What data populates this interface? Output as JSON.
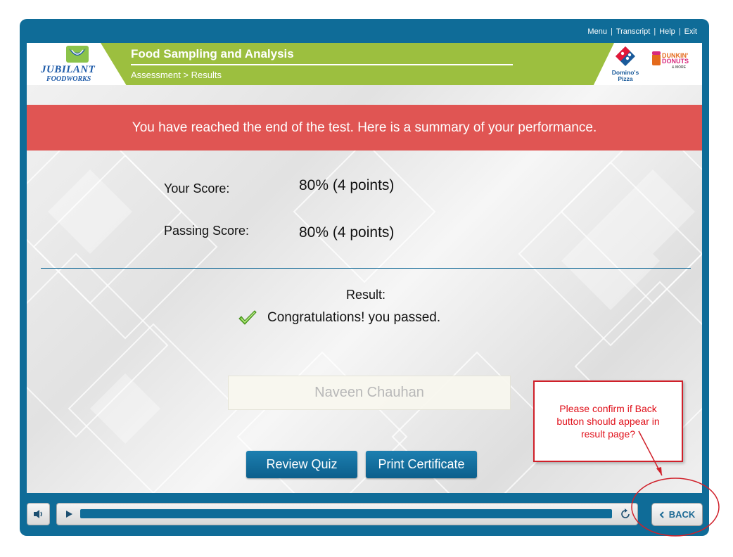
{
  "top_nav": {
    "menu": "Menu",
    "transcript": "Transcript",
    "help": "Help",
    "exit": "Exit",
    "separator": "|"
  },
  "header": {
    "logo_line1": "JUBILANT",
    "logo_line2": "FOODWORKS",
    "course_title": "Food Sampling and Analysis",
    "breadcrumb": "Assessment > Results",
    "brand_dominos": "Domino's Pizza",
    "brand_dunkin_line1": "DUNKIN'",
    "brand_dunkin_line2": "DONUTS",
    "brand_dunkin_more": "& MORE"
  },
  "banner": {
    "text": "You have reached the end of the test. Here is a summary of your performance."
  },
  "summary": {
    "your_score_label": "Your Score:",
    "your_score_value": "80% (4 points)",
    "passing_score_label": "Passing Score:",
    "passing_score_value": "80% (4 points)",
    "result_label": "Result:",
    "result_text": "Congratulations! you passed."
  },
  "learner": {
    "name": "Naveen Chauhan"
  },
  "actions": {
    "review_quiz": "Review Quiz",
    "print_certificate": "Print Certificate"
  },
  "annotation": {
    "callout_text": "Please confirm if Back button should appear in result page?"
  },
  "player": {
    "back_label": "BACK"
  },
  "colors": {
    "frame": "#0f6c98",
    "banner": "#e05553",
    "title_band": "#9cbf3f",
    "button": "#1372a3",
    "annotation": "#d0202a"
  },
  "icons": [
    "audio-icon",
    "play-icon",
    "replay-icon",
    "chevron-left-icon",
    "checkmark-icon",
    "dominos-logo-icon",
    "dunkin-logo-icon",
    "jubilant-logo-icon"
  ]
}
